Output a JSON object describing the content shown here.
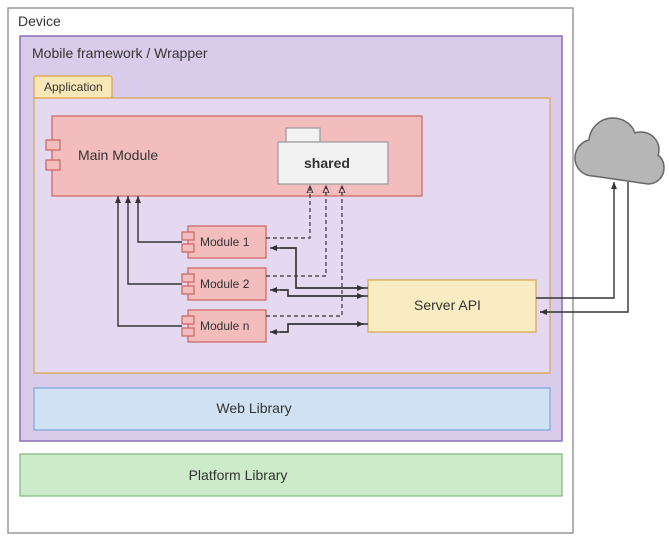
{
  "device": {
    "label": "Device"
  },
  "wrapper": {
    "label": "Mobile framework / Wrapper"
  },
  "application": {
    "tab_label": "Application"
  },
  "main_module": {
    "label": "Main Module"
  },
  "shared": {
    "label": "shared"
  },
  "modules": [
    {
      "label": "Module 1"
    },
    {
      "label": "Module 2"
    },
    {
      "label": "Module n"
    }
  ],
  "server_api": {
    "label": "Server API"
  },
  "web_library": {
    "label": "Web Library"
  },
  "platform_library": {
    "label": "Platform Library"
  },
  "colors": {
    "device_fill": "#ffffff",
    "device_stroke": "#999999",
    "wrapper_fill": "#d9ccea",
    "wrapper_stroke": "#8a6fb8",
    "app_fill": "#e4d9f0",
    "app_stroke": "#d9a547",
    "app_tab_fill": "#f9e7b8",
    "app_tab_stroke": "#d9a547",
    "pink_fill": "#f2bdbc",
    "pink_stroke": "#c9635f",
    "shared_fill": "#f2f2f2",
    "shared_stroke": "#999999",
    "server_fill": "#faecc2",
    "server_stroke": "#d1a84a",
    "web_fill": "#cfe1f3",
    "web_stroke": "#7ca6d6",
    "platform_fill": "#ccebc9",
    "platform_stroke": "#7fb87a",
    "cloud_fill": "#b6b6b6",
    "cloud_stroke": "#666666",
    "arrow": "#333333"
  }
}
